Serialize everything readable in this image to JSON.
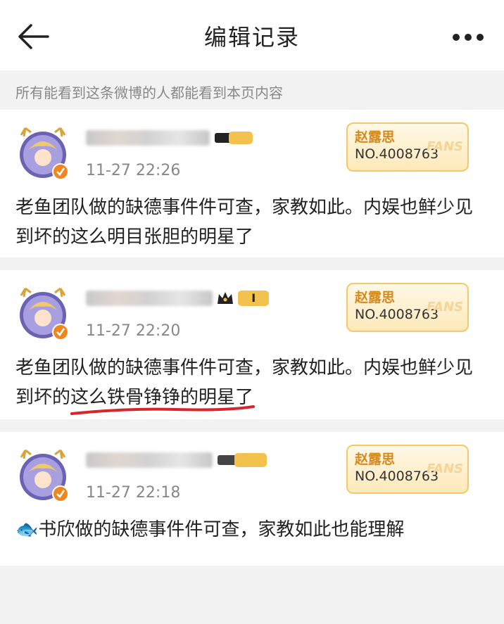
{
  "header": {
    "title": "编辑记录"
  },
  "notice": "所有能看到这条微博的人都能看到本页内容",
  "records": [
    {
      "time": "11-27 22:26",
      "fans_badge_name": "赵露思",
      "fans_badge_no": "NO.4008763",
      "fans_badge_watermark": "FANS",
      "text": "老鱼团队做的缺德事件件可查，家教如此。内娱也鲜少见到坏的这么明目张胆的明星了"
    },
    {
      "time": "11-27 22:20",
      "fans_badge_name": "赵露思",
      "fans_badge_no": "NO.4008763",
      "fans_badge_watermark": "FANS",
      "text": "老鱼团队做的缺德事件件可查，家教如此。内娱也鲜少见到坏的这么铁骨铮铮的明星了",
      "level_badge": "I"
    },
    {
      "time": "11-27 22:18",
      "fans_badge_name": "赵露思",
      "fans_badge_no": "NO.4008763",
      "fans_badge_watermark": "FANS",
      "text": "🐟书欣做的缺德事件件可查，家教如此也能理解"
    }
  ],
  "colors": {
    "underline": "#d7262b",
    "verified": "#f0861f",
    "badge_border": "#f3c96b"
  }
}
